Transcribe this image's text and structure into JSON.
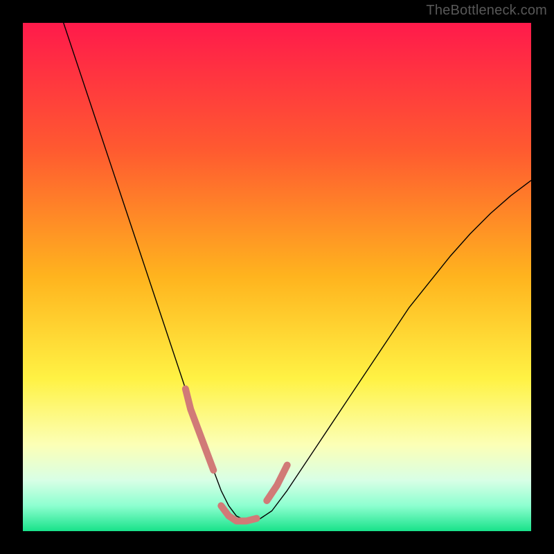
{
  "watermark": "TheBottleneck.com",
  "chart_data": {
    "type": "line",
    "title": "",
    "xlabel": "",
    "ylabel": "",
    "xlim": [
      0,
      100
    ],
    "ylim": [
      0,
      100
    ],
    "grid": false,
    "legend": false,
    "gradient_stops": [
      {
        "offset": 0.0,
        "color": "#ff1a4b"
      },
      {
        "offset": 0.25,
        "color": "#ff5a30"
      },
      {
        "offset": 0.5,
        "color": "#ffb41e"
      },
      {
        "offset": 0.7,
        "color": "#fff244"
      },
      {
        "offset": 0.83,
        "color": "#fcffb6"
      },
      {
        "offset": 0.9,
        "color": "#d8ffe6"
      },
      {
        "offset": 0.95,
        "color": "#8dffd0"
      },
      {
        "offset": 1.0,
        "color": "#18e28a"
      }
    ],
    "series": [
      {
        "name": "bottleneck-curve",
        "stroke": "#000000",
        "stroke_width": 1.4,
        "x": [
          8,
          10,
          12,
          14,
          16,
          18,
          20,
          22,
          24,
          26,
          28,
          30,
          32,
          33,
          34.5,
          36,
          37.5,
          39,
          40.5,
          42,
          44,
          46,
          49,
          52,
          56,
          60,
          64,
          68,
          72,
          76,
          80,
          84,
          88,
          92,
          96,
          100
        ],
        "y": [
          100,
          94,
          88,
          82,
          76,
          70,
          64,
          58,
          52,
          46,
          40,
          34,
          28,
          24,
          20,
          16,
          12,
          8,
          5,
          3,
          2,
          2,
          4,
          8,
          14,
          20,
          26,
          32,
          38,
          44,
          49,
          54,
          58.5,
          62.5,
          66,
          69
        ]
      },
      {
        "name": "highlight-left",
        "stroke": "#d17a77",
        "stroke_width": 10,
        "x": [
          32,
          33,
          34.5,
          36,
          37.5
        ],
        "y": [
          28,
          24,
          20,
          16,
          12
        ]
      },
      {
        "name": "highlight-bottom",
        "stroke": "#d17a77",
        "stroke_width": 10,
        "x": [
          39,
          40.5,
          42,
          44,
          46
        ],
        "y": [
          5,
          3,
          2,
          2,
          2.5
        ]
      },
      {
        "name": "highlight-right",
        "stroke": "#d17a77",
        "stroke_width": 10,
        "x": [
          48,
          50,
          52
        ],
        "y": [
          6,
          9,
          13
        ]
      }
    ]
  }
}
